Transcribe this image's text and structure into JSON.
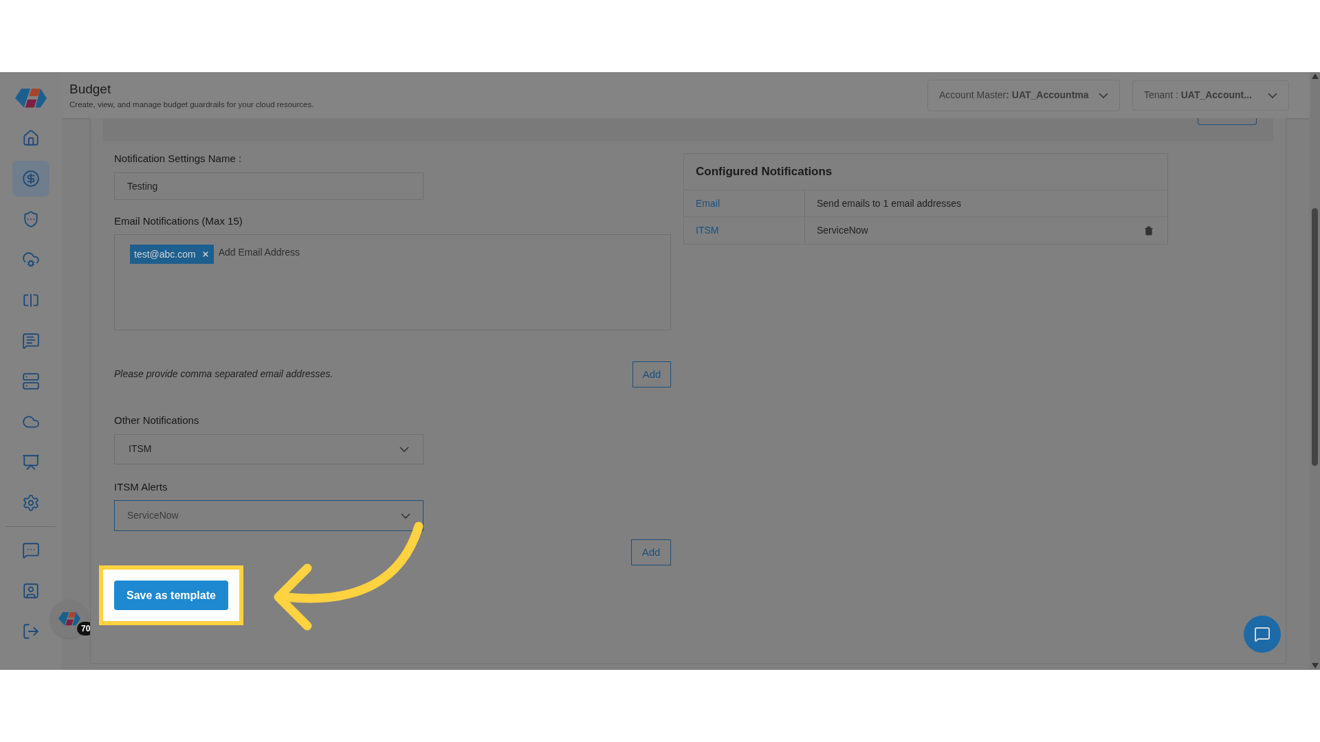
{
  "header": {
    "title": "Budget",
    "subtitle": "Create, view, and manage budget guardrails for your cloud resources.",
    "account": "Account Master**: UAT_Accountma**",
    "tenant": "Tenant : **UAT_Account...**"
  },
  "sidebar": {
    "main": [
      {
        "selected": false
      },
      {
        "selected": true
      },
      {
        "selected": false
      },
      {
        "selected": false
      },
      {
        "selected": false
      },
      {
        "selected": false
      },
      {
        "selected": false
      },
      {
        "selected": false
      },
      {
        "selected": false
      },
      {
        "selected": false
      }
    ],
    "bottom": [
      {
        "selected": false
      },
      {
        "selected": false
      },
      {
        "selected": false
      }
    ],
    "badge": "70"
  },
  "form": {
    "name_label": "Notification Settings Name :",
    "name_value": "Testing",
    "email_label": "Email Notifications (Max 15)",
    "chips": [
      {
        "text": "test@abc.com"
      }
    ],
    "email_placeholder": "Add Email Address",
    "hint": "Please provide comma separated email addresses.",
    "email_add": "Add",
    "other_label": "Other Notifications",
    "other_value": "ITSM",
    "itsm_label": "ITSM Alerts",
    "itsm_value": "ServiceNow",
    "itsm_focused": true,
    "itsm_add": "Add",
    "save": "Save as template",
    "save_highlighted": true
  },
  "configured": {
    "title": "Configured Notifications",
    "rows": [
      {
        "type": "Email",
        "detail": "Send emails to 1 email addresses",
        "deletable": false
      },
      {
        "type": "ITSM",
        "detail": "ServiceNow",
        "deletable": true
      }
    ]
  }
}
